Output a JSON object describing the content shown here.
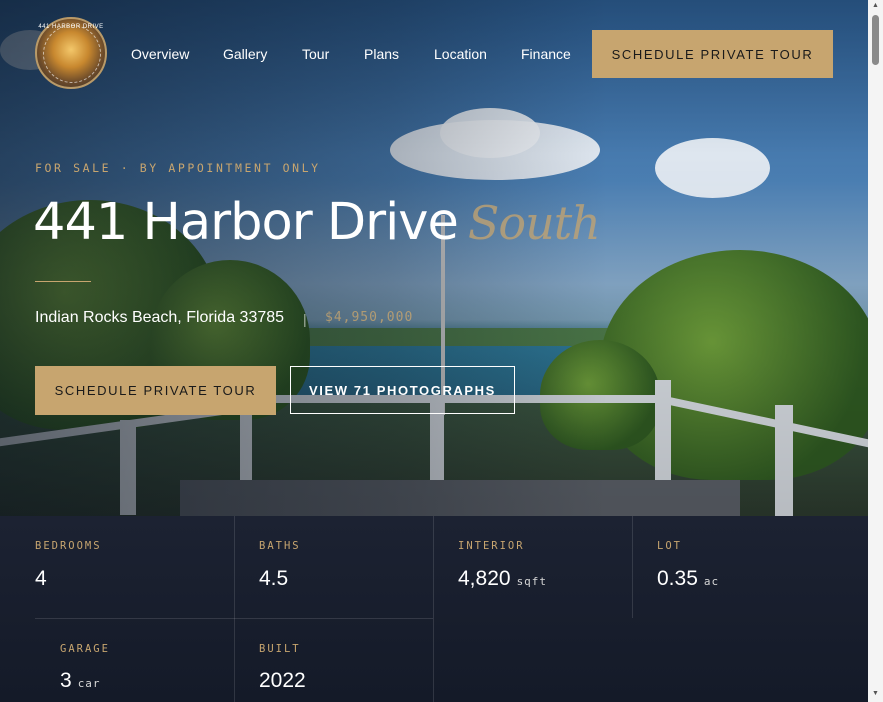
{
  "nav": {
    "logo_text": "441 HARBOR DRIVE",
    "links": [
      "Overview",
      "Gallery",
      "Tour",
      "Plans",
      "Location",
      "Finance"
    ],
    "cta": "SCHEDULE PRIVATE TOUR"
  },
  "hero": {
    "eyebrow": "FOR SALE · BY APPOINTMENT ONLY",
    "title": "441 Harbor Drive",
    "title_accent": "South",
    "address": "Indian Rocks Beach, Florida 33785",
    "separator": "|",
    "price": "$4,950,000",
    "primary_button": "SCHEDULE PRIVATE TOUR",
    "secondary_button": "VIEW 71 PHOTOGRAPHS"
  },
  "stats": [
    {
      "label": "BEDROOMS",
      "value": "4",
      "unit": ""
    },
    {
      "label": "BATHS",
      "value": "4.5",
      "unit": ""
    },
    {
      "label": "INTERIOR",
      "value": "4,820",
      "unit": "sqft"
    },
    {
      "label": "LOT",
      "value": "0.35",
      "unit": "ac"
    },
    {
      "label": "GARAGE",
      "value": "3",
      "unit": "car"
    },
    {
      "label": "BUILT",
      "value": "2022",
      "unit": ""
    }
  ],
  "colors": {
    "accent": "#c7a56f",
    "stats_background": "#1a2030",
    "text": "#ffffff"
  },
  "icons": {
    "scroll_up": "triangle-up",
    "scroll_down": "triangle-down"
  }
}
